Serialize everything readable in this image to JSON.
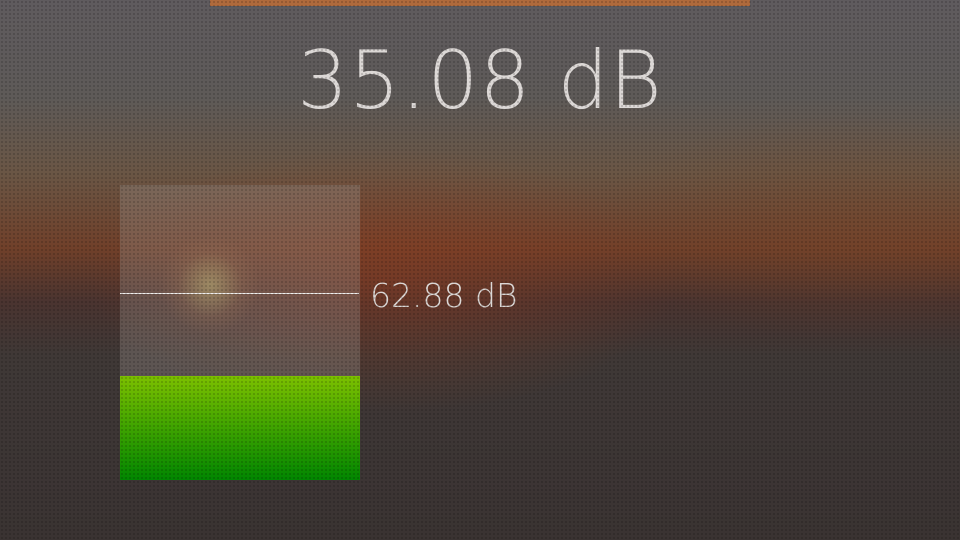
{
  "header": {
    "accent_color": "#b06a3c"
  },
  "readout": {
    "current_level": "35.08 dB"
  },
  "meter": {
    "fill_fraction": 0.353,
    "fill_color_top": "#7cc000",
    "fill_color_bottom": "#018600",
    "peak_fraction": 0.634,
    "peak_label": "62.88 dB"
  }
}
